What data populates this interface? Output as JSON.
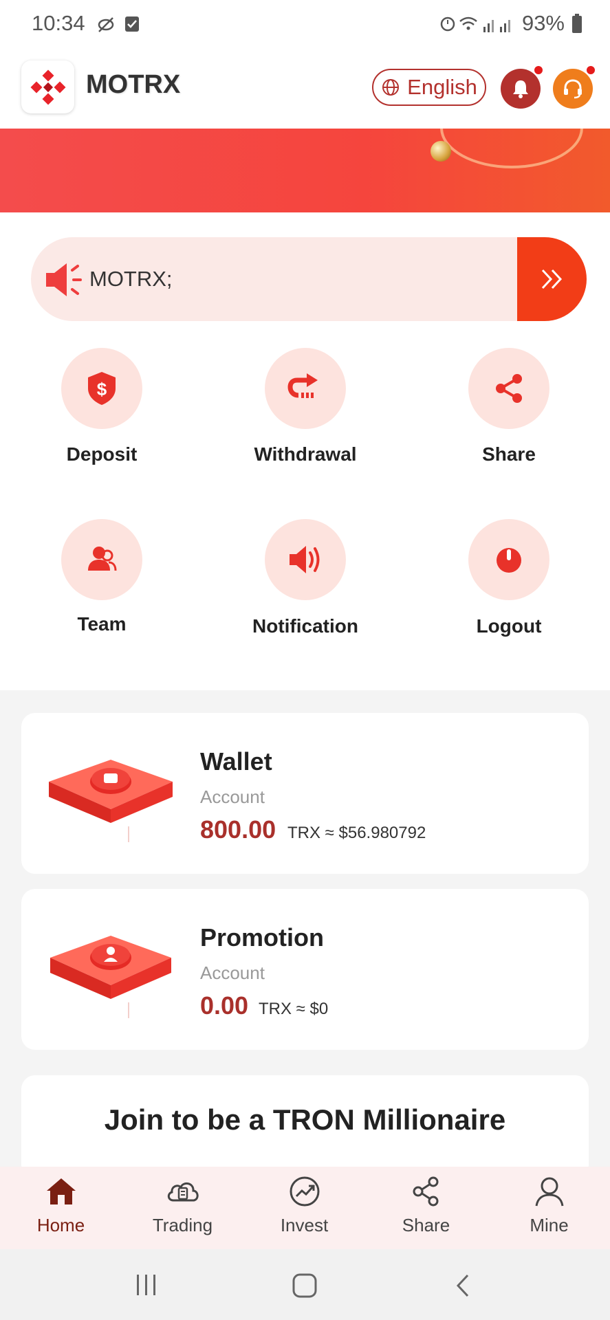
{
  "status_bar": {
    "time": "10:34",
    "battery": "93%"
  },
  "header": {
    "brand": "MOTRX",
    "language": "English"
  },
  "marquee": {
    "text": "MOTRX;",
    "go_label": "»"
  },
  "quick_actions": [
    {
      "label": "Deposit",
      "icon": "shield-dollar-icon"
    },
    {
      "label": "Withdrawal",
      "icon": "withdraw-arrow-icon"
    },
    {
      "label": "Share",
      "icon": "share-icon"
    },
    {
      "label": "Team",
      "icon": "team-icon"
    },
    {
      "label": "Notification",
      "icon": "speaker-icon"
    },
    {
      "label": "Logout",
      "icon": "power-icon"
    }
  ],
  "wallet": {
    "title": "Wallet",
    "subtitle": "Account",
    "amount": "800.00",
    "unit": "TRX ≈ $56.980792"
  },
  "promotion": {
    "title": "Promotion",
    "subtitle": "Account",
    "amount": "0.00",
    "unit": "TRX ≈ $0"
  },
  "join": {
    "title": "Join to be a TRON Millionaire"
  },
  "bottom_nav": [
    {
      "label": "Home",
      "icon": "home-icon",
      "active": true
    },
    {
      "label": "Trading",
      "icon": "trading-icon",
      "active": false
    },
    {
      "label": "Invest",
      "icon": "invest-icon",
      "active": false
    },
    {
      "label": "Share",
      "icon": "share-icon",
      "active": false
    },
    {
      "label": "Mine",
      "icon": "user-icon",
      "active": false
    }
  ],
  "colors": {
    "accent": "#b3312d",
    "brand_red": "#f23d17",
    "support": "#ef7d1c",
    "amount": "#a9302b"
  }
}
